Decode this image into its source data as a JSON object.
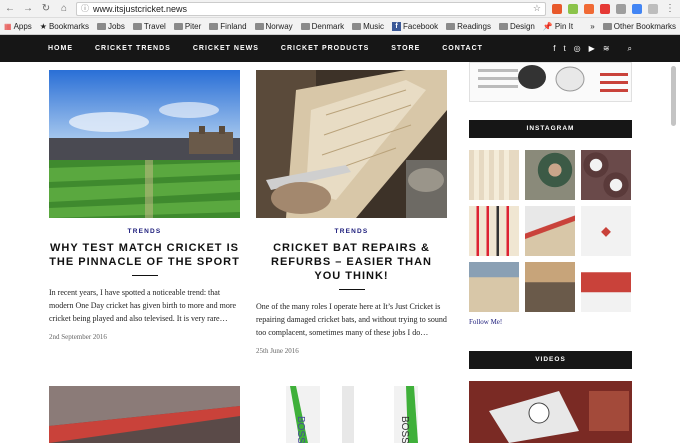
{
  "browser": {
    "url": "www.itsjustcricket.news",
    "bookmarks": [
      "Apps",
      "Bookmarks",
      "Jobs",
      "Travel",
      "Piter",
      "Finland",
      "Norway",
      "Denmark",
      "Music",
      "Facebook",
      "Readings",
      "Design",
      "Pin It",
      "»",
      "Other Bookmarks"
    ]
  },
  "nav": {
    "items": [
      "HOME",
      "CRICKET TRENDS",
      "CRICKET NEWS",
      "CRICKET PRODUCTS",
      "STORE",
      "CONTACT"
    ]
  },
  "posts": [
    {
      "category": "TRENDS",
      "title": "WHY TEST MATCH CRICKET IS THE PINNACLE OF THE SPORT",
      "excerpt": "In recent years, I have spotted a noticeable trend: that modern One Day cricket has given birth to more and more cricket being played and also televised. It is very rare…",
      "date": "2nd September 2016"
    },
    {
      "category": "TRENDS",
      "title": "CRICKET BAT REPAIRS & REFURBS – EASIER THAN YOU THINK!",
      "excerpt": "One of the many roles I operate here at It’s Just Cricket is repairing damaged cricket bats, and without trying to sound too complacent, sometimes many of these jobs I do…",
      "date": "25th June 2016"
    }
  ],
  "sidebar": {
    "instagram_title": "INSTAGRAM",
    "follow": "Follow Me!",
    "videos_title": "VIDEOS"
  },
  "colors": {
    "nav_bg": "#161616",
    "accent": "#1a1a7a"
  }
}
